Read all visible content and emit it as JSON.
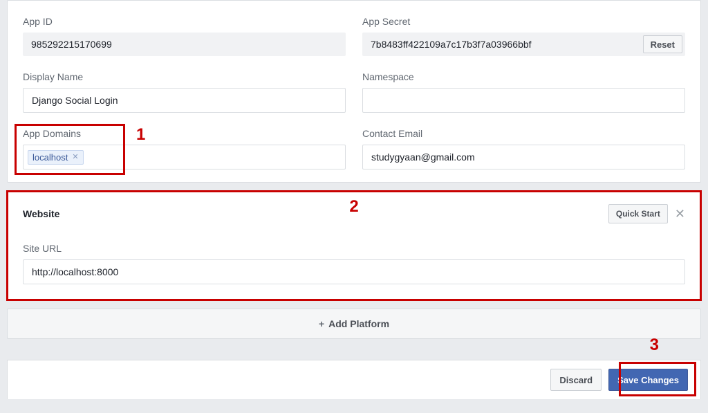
{
  "basic": {
    "app_id_label": "App ID",
    "app_id_value": "985292215170699",
    "app_secret_label": "App Secret",
    "app_secret_value": "7b8483ff422109a7c17b3f7a03966bbf",
    "reset_label": "Reset",
    "display_name_label": "Display Name",
    "display_name_value": "Django Social Login",
    "namespace_label": "Namespace",
    "namespace_value": "",
    "app_domains_label": "App Domains",
    "domain_token": "localhost",
    "contact_email_label": "Contact Email",
    "contact_email_value": "studygyaan@gmail.com"
  },
  "website": {
    "heading": "Website",
    "quick_start_label": "Quick Start",
    "site_url_label": "Site URL",
    "site_url_value": "http://localhost:8000"
  },
  "add_platform_label": "Add Platform",
  "footer": {
    "discard_label": "Discard",
    "save_label": "Save Changes"
  },
  "annotations": {
    "n1": "1",
    "n2": "2",
    "n3": "3"
  }
}
